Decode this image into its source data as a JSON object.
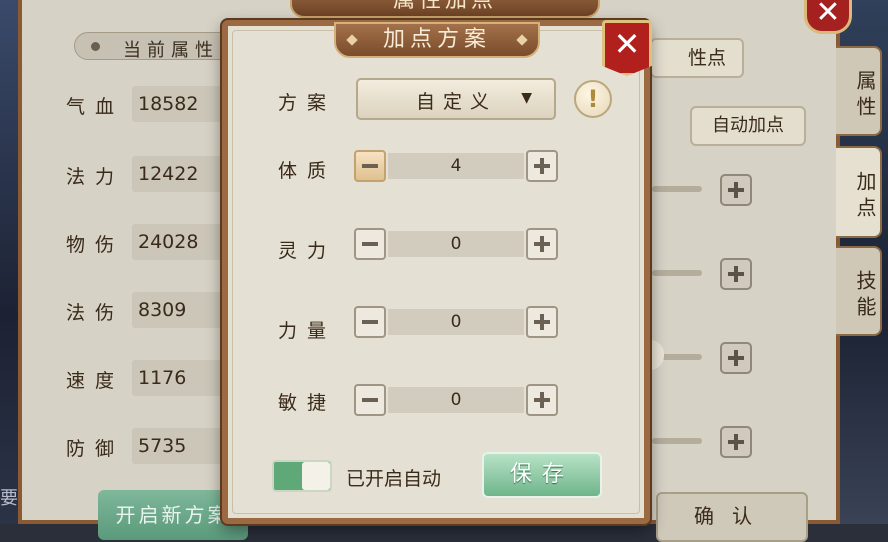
{
  "background": {
    "window_title": "属性加点",
    "current_attrs_tab": "当前属性",
    "stats": [
      {
        "label": "气血",
        "value": "18582"
      },
      {
        "label": "法力",
        "value": "12422"
      },
      {
        "label": "物伤",
        "value": "24028"
      },
      {
        "label": "法伤",
        "value": "8309"
      },
      {
        "label": "速度",
        "value": "1176"
      },
      {
        "label": "防御",
        "value": "5735"
      }
    ],
    "new_plan_button": "开启新方案",
    "attr_points_button": "性点",
    "auto_add_button": "自动加点",
    "confirm_button": "确认",
    "side_tabs": [
      "属性",
      "加点",
      "技能"
    ],
    "left_partial_text": "要"
  },
  "dialog": {
    "title": "加点方案",
    "close_glyph": "✕",
    "plan_label": "方案",
    "plan_value": "自定义",
    "plan_arrow": "▼",
    "info_glyph": "!",
    "attributes": [
      {
        "label": "体质",
        "value": "4"
      },
      {
        "label": "灵力",
        "value": "0"
      },
      {
        "label": "力量",
        "value": "0"
      },
      {
        "label": "敏捷",
        "value": "0"
      }
    ],
    "auto_toggle_label": "已开启自动",
    "auto_toggle_on": true,
    "save_button": "保存"
  },
  "colors": {
    "dialog_border": "#9b6a43",
    "close_red": "#b1201c",
    "save_green": "#6fb58b",
    "toggle_green": "#5fa978"
  },
  "icons": [
    "close-icon",
    "info-icon",
    "minus-icon",
    "plus-icon",
    "dropdown-arrow-icon"
  ]
}
